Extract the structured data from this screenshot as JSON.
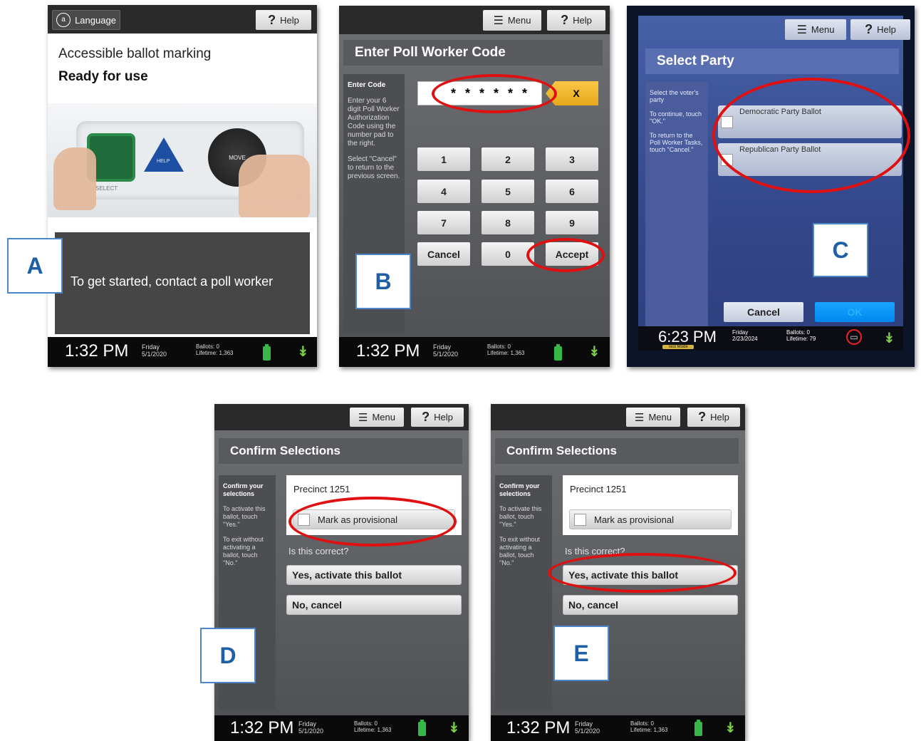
{
  "panel_a": {
    "label": "A",
    "language_label": "Language",
    "help_label": "Help",
    "title": "Accessible ballot marking",
    "subtitle": "Ready for use",
    "device_buttons": [
      "SELECT",
      "HELP",
      "MOVE"
    ],
    "prompt": "To get started, contact a poll worker",
    "status": {
      "time": "1:32 PM",
      "day": "Friday",
      "date": "5/1/2020",
      "ballots": "Ballots:  0",
      "lifetime": "Lifetime:  1,363"
    }
  },
  "panel_b": {
    "label": "B",
    "menu_label": "Menu",
    "help_label": "Help",
    "title": "Enter Poll Worker Code",
    "side_heading": "Enter Code",
    "side_text_1": "Enter your 6 digit Poll Worker Authorization Code using the number pad to the right.",
    "side_text_2": "Select \"Cancel\" to return to the previous screen.",
    "code_value": "* * * * * *",
    "clear_label": "X",
    "keys": [
      "1",
      "2",
      "3",
      "4",
      "5",
      "6",
      "7",
      "8",
      "9"
    ],
    "cancel_label": "Cancel",
    "zero_label": "0",
    "accept_label": "Accept",
    "status": {
      "time": "1:32 PM",
      "day": "Friday",
      "date": "5/1/2020",
      "ballots": "Ballots:  0",
      "lifetime": "Lifetime:  1,363"
    }
  },
  "panel_c": {
    "label": "C",
    "menu_label": "Menu",
    "help_label": "Help",
    "title": "Select Party",
    "side_text_1": "Select the voter's party",
    "side_text_2": "To continue, touch \"OK.\"",
    "side_text_3": "To return to the Poll Worker Tasks, touch \"Cancel.\"",
    "options": [
      "Democratic Party Ballot",
      "Republican Party Ballot"
    ],
    "cancel_label": "Cancel",
    "ok_label": "OK",
    "status": {
      "time": "6:23 PM",
      "day": "Friday",
      "date": "2/23/2024",
      "mode": "Test Mode",
      "ballots": "Ballots:  0",
      "lifetime": "Lifetime:  79"
    }
  },
  "panel_d": {
    "label": "D",
    "menu_label": "Menu",
    "help_label": "Help",
    "title": "Confirm Selections",
    "side_heading": "Confirm your selections",
    "side_text_1": "To activate this ballot, touch \"Yes.\"",
    "side_text_2": "To exit without activating a ballot, touch \"No.\"",
    "precinct": "Precinct 1251",
    "provisional_label": "Mark as provisional",
    "question": "Is this correct?",
    "yes_label": "Yes, activate this ballot",
    "no_label": "No, cancel",
    "status": {
      "time": "1:32 PM",
      "day": "Friday",
      "date": "5/1/2020",
      "ballots": "Ballots:  0",
      "lifetime": "Lifetime:  1,363"
    }
  },
  "panel_e": {
    "label": "E",
    "menu_label": "Menu",
    "help_label": "Help",
    "title": "Confirm Selections",
    "side_heading": "Confirm your selections",
    "side_text_1": "To activate this ballot, touch \"Yes.\"",
    "side_text_2": "To exit without activating a ballot, touch \"No.\"",
    "precinct": "Precinct 1251",
    "provisional_label": "Mark as provisional",
    "question": "Is this correct?",
    "yes_label": "Yes, activate this ballot",
    "no_label": "No, cancel",
    "status": {
      "time": "1:32 PM",
      "day": "Friday",
      "date": "5/1/2020",
      "ballots": "Ballots:  0",
      "lifetime": "Lifetime:  1,363"
    }
  },
  "colors": {
    "highlight_ring": "#e01010",
    "label_border": "#4a86c8",
    "label_text": "#1f5fa6",
    "battery": "#37b64a"
  }
}
